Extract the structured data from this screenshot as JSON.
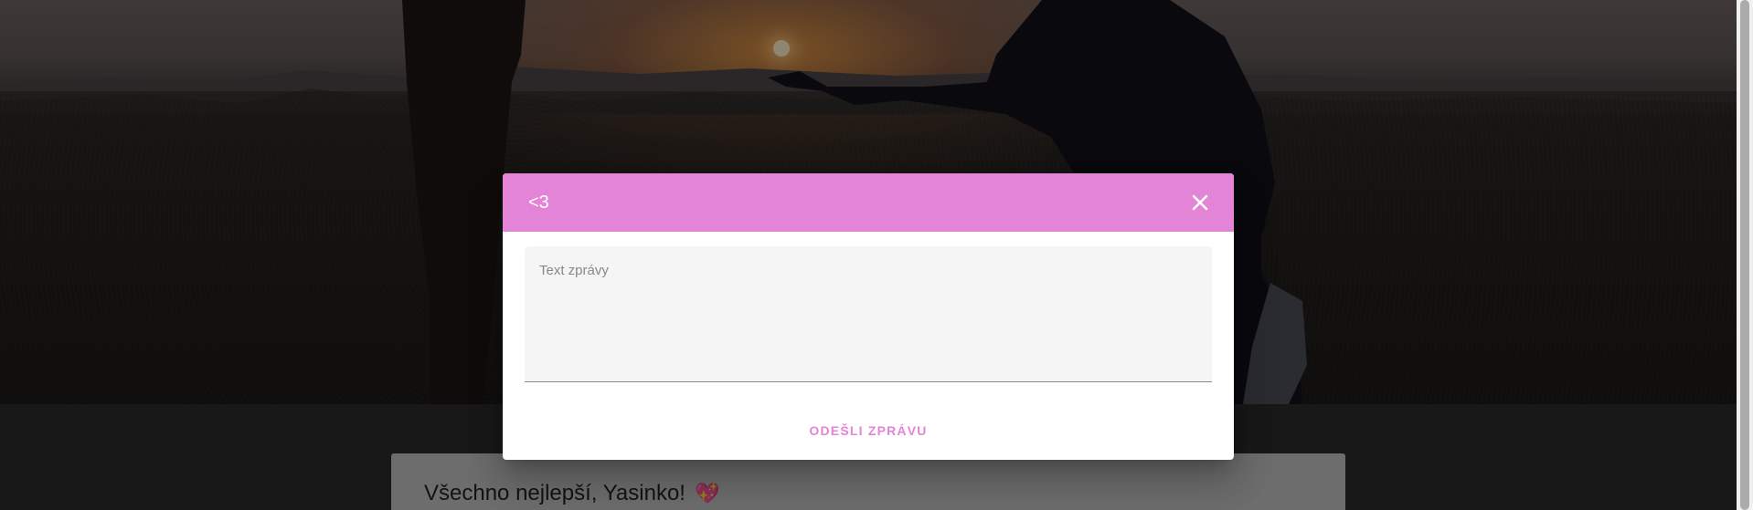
{
  "dialog": {
    "title": "<3",
    "close_icon": "close-icon",
    "message_placeholder": "Text zprávy",
    "message_value": "",
    "send_label": "ODEŠLI ZPRÁVU",
    "accent_color": "#e384d6"
  },
  "page": {
    "card_title": "Všechno nejlepší, Yasinko!",
    "card_icon": "heart-icon",
    "card_icon_glyph": "💖"
  }
}
